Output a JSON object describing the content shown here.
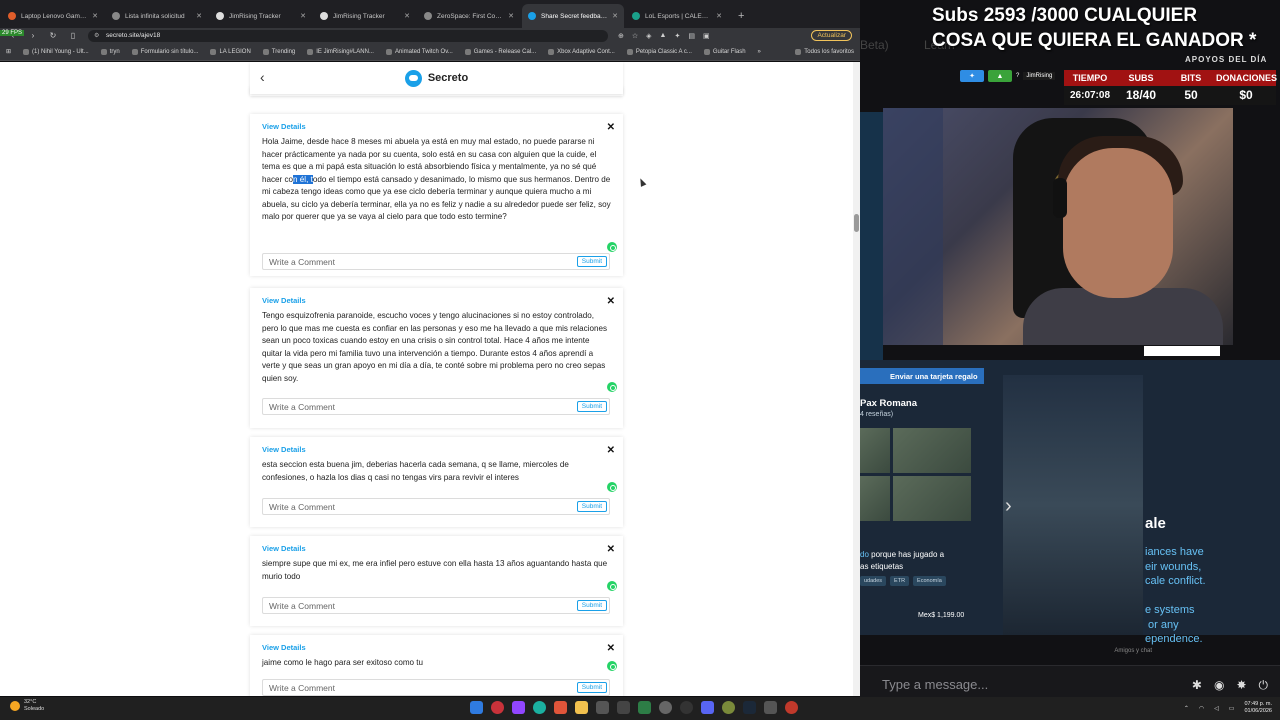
{
  "browser": {
    "tabs": [
      {
        "label": "Laptop Lenovo Gaming Legion",
        "color": "#e05d2a",
        "active": false
      },
      {
        "label": "Lista infinita solicitud",
        "color": "#888888",
        "active": false
      },
      {
        "label": "JimRising Tracker",
        "color": "#dddddd",
        "active": false
      },
      {
        "label": "JimRising Tracker",
        "color": "#dddddd",
        "active": false
      },
      {
        "label": "ZeroSpace: First Contact Invit",
        "color": "#888888",
        "active": false
      },
      {
        "label": "Share Secret feedback about",
        "color": "#1aa0e8",
        "active": true
      },
      {
        "label": "LoL Esports | CALENDARIO",
        "color": "#1aa08a",
        "active": false
      }
    ],
    "new_tab": "+",
    "url": "secreto.site/ajev18",
    "update_label": "Actualizar",
    "bookmarks": [
      "(1) Nihil Young - Ult...",
      "tryn",
      "Formulario sin título...",
      "LA LEGION",
      "Trending",
      "IE JimRising#LANN...",
      "Animated Twitch Ov...",
      "Games - Release Cal...",
      "Xbox Adaptive Cont...",
      "Petopia Classic A c...",
      "Guitar Flash"
    ],
    "bookmarks_all": "Todos los favoritos",
    "fps": "29 FPS"
  },
  "app": {
    "title": "Secreto",
    "view_details": "View Details",
    "comment_placeholder": "Write a Comment",
    "submit": "Submit"
  },
  "messages": [
    {
      "pre": "Hola Jaime, desde hace 8 meses mi abuela ya está en muy mal estado, no puede pararse ni hacer prácticamente ya nada por su cuenta, solo está en su casa con alguien que la cuide, el tema es que a mi papá esta situación lo está absorbiendo física y mentalmente, ya no sé qué hacer co",
      "highlight": "n él, t",
      "post": "odo el tiempo está cansado y desanimado, lo mismo que sus hermanos. Dentro de mi cabeza tengo ideas como que ya ese ciclo debería terminar y aunque quiera mucho a mi abuela, su ciclo ya debería terminar, ella ya no es feliz y nadie a su alrededor puede ser feliz, soy malo por querer que ya se vaya al cielo para que todo esto termine?"
    },
    {
      "pre": "Tengo esquizofrenia paranoide, escucho voces y tengo alucinaciones si no estoy controlado, pero lo que mas me cuesta es confiar en las personas y eso me ha llevado a que mis relaciones sean un poco toxicas cuando estoy en una crisis o sin control total. Hace 4 años me intente quitar la vida pero mi familia tuvo una intervención a tiempo. Durante estos 4 años aprendí a verte y que seas un gran apoyo en mi día a día, te conté sobre mi problema pero no creo sepas quien soy.",
      "highlight": "",
      "post": ""
    },
    {
      "pre": "esta seccion esta buena jim, deberias hacerla cada semana, q se llame, miercoles de confesiones, o hazla los dias q casi no tengas virs para revivir el interes",
      "highlight": "",
      "post": ""
    },
    {
      "pre": "siempre supe que mi ex, me era infiel pero estuve con ella hasta 13 años aguantando hasta que murio todo",
      "highlight": "",
      "post": ""
    },
    {
      "pre": "jaime como le hago para ser exitoso como tu",
      "highlight": "",
      "post": ""
    }
  ],
  "taskbar": {
    "temp": "32°C",
    "weather": "Soleado",
    "time": "07:49 p. m.",
    "date": "01/06/2026"
  },
  "overlay": {
    "subs_line1": "Subs 2593 /3000 CUALQUIER",
    "subs_line2": "COSA QUE QUIERA EL GANADOR *",
    "ghost_beta": "Beta)",
    "ghost_learn": "Learn",
    "apoyos": "APOYOS DEL DÍA",
    "channel": "JimRising",
    "question": "?",
    "stats_headers": [
      "TIEMPO",
      "SUBS",
      "BITS",
      "DONACIONES"
    ],
    "stats_values": [
      "26:07:08",
      "18/40",
      "50",
      "$0"
    ],
    "gift_label": "Enviar una tarjeta regalo",
    "game_title": "Pax Romana",
    "reviews": "4 reseñas)",
    "played_link": "do",
    "played_text": " porque has jugado a",
    "played_text2": "as etiquetas",
    "tags": [
      "udades",
      "ETR",
      "Economía"
    ],
    "price": "Mex$ 1,199.00",
    "game2_title": "ale",
    "game2_desc": "iances have\neir wounds,\ncale conflict.\n\ne systems\n or any\nependence.",
    "friends_chat": "Amigos y chat",
    "chat_placeholder": "Type a message..."
  }
}
